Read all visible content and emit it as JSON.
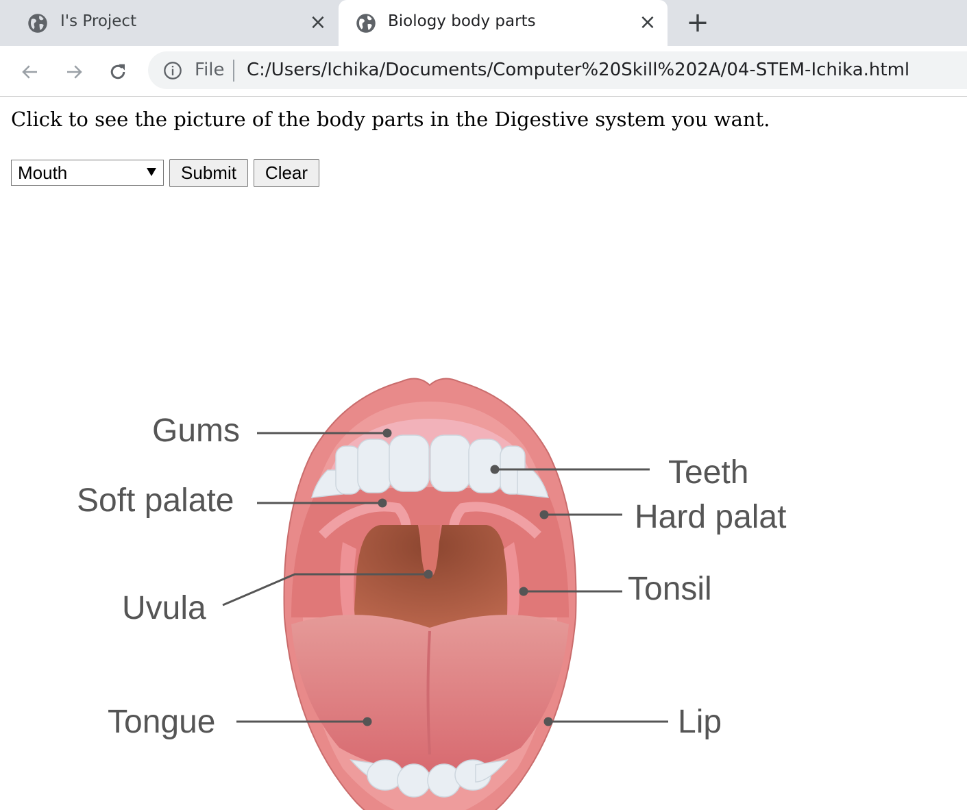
{
  "browser": {
    "tabs": [
      {
        "title": "I's Project",
        "active": false
      },
      {
        "title": "Biology body parts",
        "active": true
      }
    ],
    "address_bar": {
      "scheme_label": "File",
      "url": "C:/Users/Ichika/Documents/Computer%20Skill%202A/04-STEM-Ichika.html"
    }
  },
  "page": {
    "instructions": "Click to see the picture of the body parts in the Digestive system you want.",
    "form": {
      "selected_part": "Mouth",
      "submit_label": "Submit",
      "clear_label": "Clear"
    },
    "diagram": {
      "labels": {
        "gums": "Gums",
        "soft_palate": "Soft palate",
        "uvula": "Uvula",
        "tongue": "Tongue",
        "teeth": "Teeth",
        "hard_palate": "Hard palat",
        "tonsil": "Tonsil",
        "lip": "Lip"
      }
    }
  },
  "colors": {
    "tabstrip": "#dee1e6",
    "lip": "#e88a8a",
    "throat": "#9a5438",
    "tongue": "#e3898b",
    "teeth": "#e9eef3",
    "label_text": "#555555"
  }
}
